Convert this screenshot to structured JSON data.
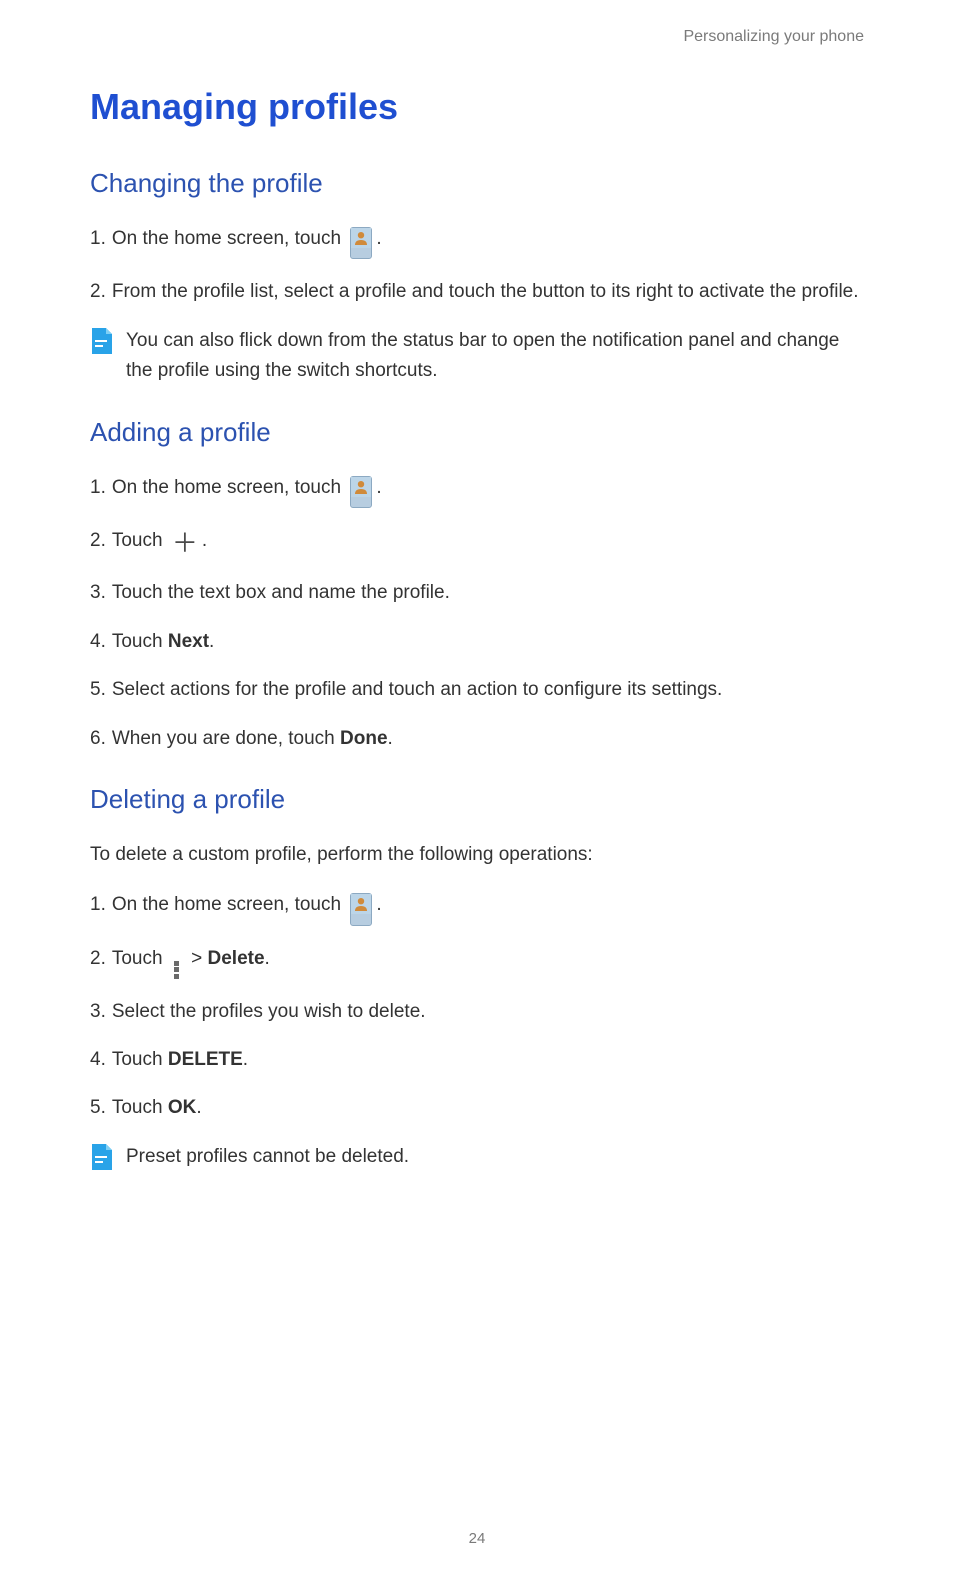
{
  "header": "Personalizing your phone",
  "title": "Managing profiles",
  "sections": {
    "changing": {
      "heading": "Changing the profile",
      "step1_pre": "On the home screen, touch ",
      "step1_post": ".",
      "step2": "From the profile list, select a profile and touch the button to its right to activate the profile.",
      "note": "You can also flick down from the status bar to open the notification panel and change the profile using the switch shortcuts."
    },
    "adding": {
      "heading": "Adding a profile",
      "step1_pre": "On the home screen, touch ",
      "step1_post": ".",
      "step2_pre": "Touch ",
      "step2_post": ".",
      "step3": "Touch the text box and name the profile.",
      "step4_pre": "Touch ",
      "step4_bold": "Next",
      "step4_post": ".",
      "step5": "Select actions for the profile and touch an action to configure its settings.",
      "step6_pre": "When you are done, touch ",
      "step6_bold": "Done",
      "step6_post": "."
    },
    "deleting": {
      "heading": "Deleting a profile",
      "intro": "To delete a custom profile, perform the following operations:",
      "step1_pre": "On the home screen, touch ",
      "step1_post": ".",
      "step2_pre": "Touch ",
      "step2_mid": " > ",
      "step2_bold": "Delete",
      "step2_post": ".",
      "step3": "Select the profiles you wish to delete.",
      "step4_pre": "Touch ",
      "step4_bold": "DELETE",
      "step4_post": ".",
      "step5_pre": "Touch ",
      "step5_bold": "OK",
      "step5_post": ".",
      "note": "Preset profiles cannot be deleted."
    }
  },
  "page_number": "24"
}
